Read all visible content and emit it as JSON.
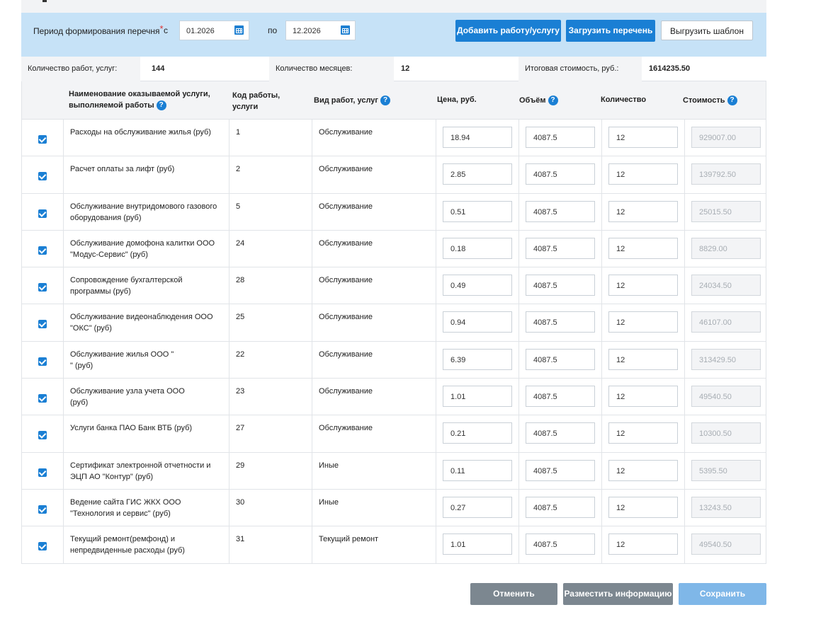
{
  "filter": {
    "period_label": "Период формирования перечня",
    "required_mark": "*",
    "from_label": "с",
    "from_value": "01.2026",
    "to_label": "по",
    "to_value": "12.2026",
    "add_button": "Добавить работу/услугу",
    "load_button": "Загрузить перечень",
    "export_button": "Выгрузить шаблон"
  },
  "summary": {
    "count_label": "Количество работ, услуг:",
    "count_value": "144",
    "months_label": "Количество месяцев:",
    "months_value": "12",
    "total_label": "Итоговая стоимость, руб.:",
    "total_value": "1614235.50"
  },
  "columns": {
    "name_line1": "Наименование оказываемой услуги,",
    "name_line2": "выполняемой работы",
    "code_line1": "Код работы,",
    "code_line2": "услуги",
    "type": "Вид работ, услуг",
    "price": "Цена, руб.",
    "volume": "Объём",
    "quantity": "Количество",
    "cost": "Стоимость",
    "help_glyph": "?"
  },
  "rows": [
    {
      "name1": "Расходы на обслуживание жилья (руб)",
      "name2": "",
      "code": "1",
      "type": "Обслуживание",
      "price": "18.94",
      "volume": "4087.5",
      "qty": "12",
      "cost": "929007.00"
    },
    {
      "name1": "Расчет оплаты за лифт (руб)",
      "name2": "",
      "code": "2",
      "type": "Обслуживание",
      "price": "2.85",
      "volume": "4087.5",
      "qty": "12",
      "cost": "139792.50"
    },
    {
      "name1": "Обслуживание внутридомового газового",
      "name2": "оборудования (руб)",
      "code": "5",
      "type": "Обслуживание",
      "price": "0.51",
      "volume": "4087.5",
      "qty": "12",
      "cost": "25015.50"
    },
    {
      "name1": "Обслуживание домофона калитки ООО",
      "name2": "\"Модус-Сервис\" (руб)",
      "code": "24",
      "type": "Обслуживание",
      "price": "0.18",
      "volume": "4087.5",
      "qty": "12",
      "cost": "8829.00"
    },
    {
      "name1": "Сопровождение бухгалтерской",
      "name2": "программы (руб)",
      "code": "28",
      "type": "Обслуживание",
      "price": "0.49",
      "volume": "4087.5",
      "qty": "12",
      "cost": "24034.50"
    },
    {
      "name1": "Обслуживание видеонаблюдения ООО",
      "name2": "\"ОКС\" (руб)",
      "code": "25",
      "type": "Обслуживание",
      "price": "0.94",
      "volume": "4087.5",
      "qty": "12",
      "cost": "46107.00"
    },
    {
      "name1": "Обслуживание жилья ООО \"",
      "name2": "\" (руб)",
      "code": "22",
      "type": "Обслуживание",
      "price": "6.39",
      "volume": "4087.5",
      "qty": "12",
      "cost": "313429.50"
    },
    {
      "name1": "Обслуживание узла учета ООО",
      "name2": "(руб)",
      "code": "23",
      "type": "Обслуживание",
      "price": "1.01",
      "volume": "4087.5",
      "qty": "12",
      "cost": "49540.50"
    },
    {
      "name1": "Услуги банка ПАО Банк ВТБ (руб)",
      "name2": "",
      "code": "27",
      "type": "Обслуживание",
      "price": "0.21",
      "volume": "4087.5",
      "qty": "12",
      "cost": "10300.50"
    },
    {
      "name1": "Сертификат электронной отчетности и",
      "name2": "ЭЦП АО \"Контур\" (руб)",
      "code": "29",
      "type": "Иные",
      "price": "0.11",
      "volume": "4087.5",
      "qty": "12",
      "cost": "5395.50"
    },
    {
      "name1": "Ведение сайта ГИС ЖКХ ООО",
      "name2": "\"Технология и сервис\" (руб)",
      "code": "30",
      "type": "Иные",
      "price": "0.27",
      "volume": "4087.5",
      "qty": "12",
      "cost": "13243.50"
    },
    {
      "name1": "Текущий ремонт(ремфонд) и",
      "name2": "непредвиденные расходы (руб)",
      "code": "31",
      "type": "Текущий ремонт",
      "price": "1.01",
      "volume": "4087.5",
      "qty": "12",
      "cost": "49540.50"
    }
  ],
  "footer": {
    "cancel": "Отменить",
    "publish": "Разместить информацию",
    "save": "Сохранить"
  },
  "colors": {
    "primary": "#1a7fd4",
    "filter_bg": "#c6e2f7",
    "cancel_bg": "#7c8790",
    "save_bg": "#7fb7e8"
  }
}
